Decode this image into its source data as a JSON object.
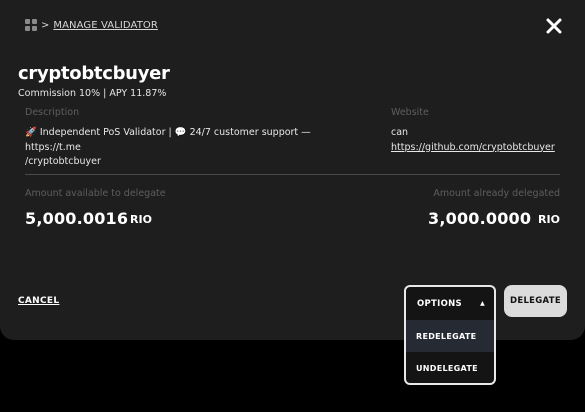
{
  "breadcrumb": {
    "separator": ">",
    "label": "MANAGE VALIDATOR"
  },
  "validator": {
    "name": "cryptobtcbuyer",
    "stats": "Commission 10% | APY 11.87%"
  },
  "description": {
    "label": "Description",
    "line1": "🚀 Independent PoS Validator | 💬 24/7 customer support — https://t.me",
    "line2": "/cryptobtcbuyer"
  },
  "website": {
    "label": "Website",
    "prefix": "can",
    "url": "https://github.com/cryptobtcbuyer"
  },
  "available": {
    "label": "Amount available to delegate",
    "value": "5,000.0016",
    "unit": "RIO"
  },
  "delegated": {
    "label": "Amount already delegated",
    "value": "3,000.0000",
    "unit": "RIO"
  },
  "actions": {
    "cancel": "CANCEL",
    "options": "OPTIONS",
    "options_caret": "▲",
    "menu": [
      "REDELEGATE",
      "UNDELEGATE"
    ],
    "delegate": "DELEGATE"
  },
  "icons": {
    "menu": "grid-icon",
    "close": "close-icon",
    "caret": "caret-up-icon"
  }
}
